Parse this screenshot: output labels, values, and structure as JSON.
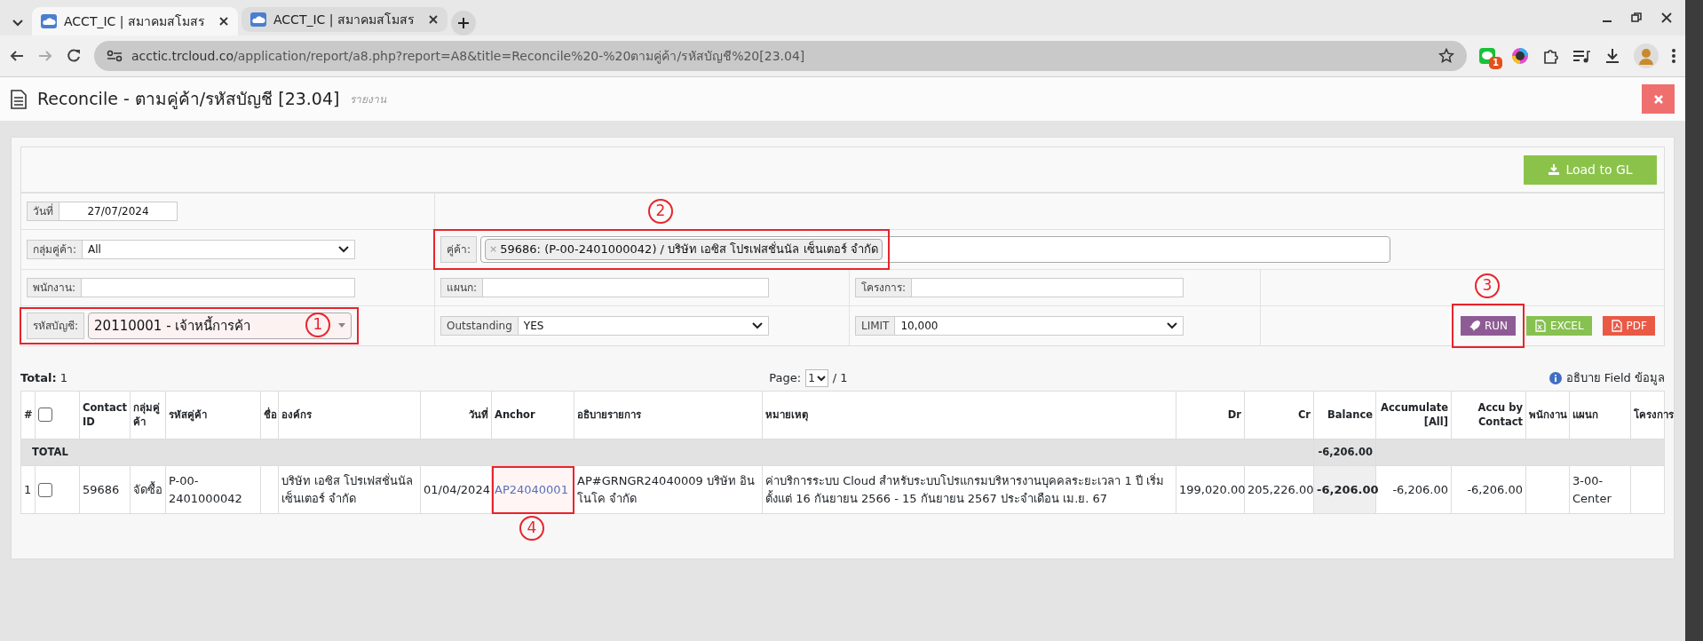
{
  "browser": {
    "tabs": [
      {
        "title": "ACCT_IC | สมาคมสโมสร",
        "selected": true
      },
      {
        "title": "ACCT_IC | สมาคมสโมสร",
        "selected": false
      }
    ],
    "url_host": "acctic.trcloud.co",
    "url_path": "/application/report/a8.php?report=A8&title=Reconcile%20-%20ตามคู่ค้า/รหัสบัญชี%20[23.04]",
    "extension_badge": "1"
  },
  "page": {
    "title": "Reconcile - ตามคู่ค้า/รหัสบัญชี [23.04]",
    "subtitle": "รายงาน"
  },
  "load_button": "Load to GL",
  "form_rows": [
    [
      {
        "kind": "date",
        "label": "วันที่",
        "value": "27/07/2024"
      },
      null
    ],
    [
      {
        "kind": "select",
        "label": "กลุ่มคู่ค้า:",
        "value": "All"
      },
      {
        "kind": "tags",
        "label": "คู่ค้า:",
        "tags": [
          {
            "remove": "×",
            "text": "59686: (P-00-2401000042) / บริษัท เอซิส โปรเฟสชั่นนัล เซ็นเตอร์ จำกัด"
          }
        ],
        "callout": "2"
      }
    ],
    [
      {
        "kind": "input",
        "label": "พนักงาน:"
      },
      {
        "kind": "input",
        "label": "แผนก:"
      },
      {
        "kind": "input",
        "label": "โครงการ:"
      },
      null
    ],
    [
      {
        "kind": "combo",
        "label": "รหัสบัญชี:",
        "value": "20110001 - เจ้าหนี้การค้า",
        "callout": "1"
      },
      {
        "kind": "select",
        "label": "Outstanding",
        "value": "YES"
      },
      {
        "kind": "select",
        "label": "LIMIT",
        "value": "10,000"
      },
      {
        "kind": "actions",
        "buttons": [
          {
            "kind": "run",
            "label": "RUN",
            "callout": "3"
          },
          {
            "kind": "excel",
            "label": "EXCEL"
          },
          {
            "kind": "pdf",
            "label": "PDF"
          }
        ]
      }
    ]
  ],
  "summary": {
    "total": "**Total:** 1",
    "page_label": "Page:",
    "page_value": "1",
    "page_count": "/ 1",
    "help": "อธิบาย Field ข้อมูล"
  },
  "table": {
    "columns": [
      {
        "kind": "text",
        "label": "#"
      },
      {
        "kind": "checkbox",
        "checked": false
      },
      {
        "kind": "text",
        "label": "Contact ID"
      },
      {
        "kind": "text",
        "label": "กลุ่มคู่ค้า"
      },
      {
        "kind": "text",
        "label": "รหัสคู่ค้า"
      },
      {
        "kind": "text",
        "label": "ชื่อ"
      },
      {
        "kind": "text",
        "label": "องค์กร"
      },
      {
        "kind": "number",
        "label": "วันที่"
      },
      {
        "kind": "link",
        "label": "Anchor"
      },
      {
        "kind": "text",
        "label": "อธิบายรายการ"
      },
      {
        "kind": "text",
        "label": "หมายเหตุ"
      },
      {
        "kind": "number",
        "label": "Dr"
      },
      {
        "kind": "number",
        "label": "Cr"
      },
      {
        "kind": "balance",
        "label": "Balance"
      },
      {
        "kind": "number",
        "label": "Accumulate [All]"
      },
      {
        "kind": "number",
        "label": "Accu by Contact"
      },
      {
        "kind": "text",
        "label": "พนักงาน"
      },
      {
        "kind": "text",
        "label": "แผนก"
      },
      {
        "kind": "text",
        "label": "โครงการ"
      }
    ],
    "total_row": {
      "label": "TOTAL",
      "balance": "-6,206.00"
    },
    "rows": [
      {
        "cells": [
          "1",
          false,
          "59686",
          "จัดซื้อ",
          "P-00-2401000042",
          null,
          "บริษัท เอซิส โปรเฟสชั่นนัล เซ็นเตอร์ จำกัด",
          "01/04/2024",
          "AP24040001",
          "AP#GRNGR24040009 บริษัท อินโนโค จำกัด",
          "ค่าบริการระบบ Cloud สำหรับระบบโปรแกรมบริหารงานบุคคลระยะเวลา 1 ปี เริ่มตั้งแต่ 16 กันยายน 2566 - 15 กันยายน 2567 ประจำเดือน เม.ย. 67",
          "199,020.00",
          "205,226.00",
          "-6,206.00",
          "-6,206.00",
          "-6,206.00",
          null,
          "3-00-Center",
          null
        ],
        "anchor_callout": "4"
      }
    ]
  }
}
